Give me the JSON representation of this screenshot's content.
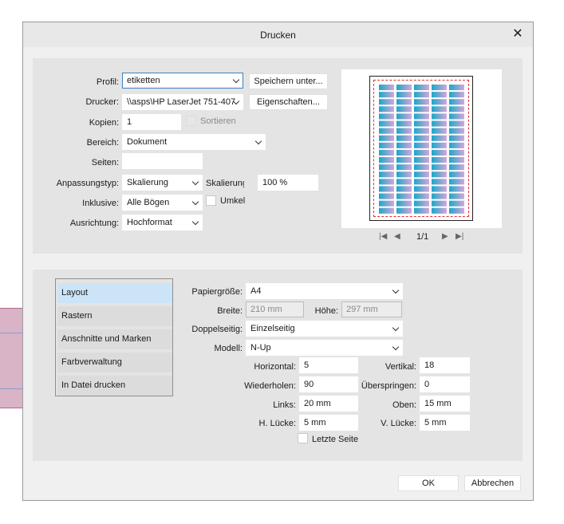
{
  "dialog": {
    "title": "Drucken"
  },
  "top": {
    "profil": {
      "label": "Profil:",
      "value": "etiketten",
      "save_button": "Speichern unter..."
    },
    "drucker": {
      "label": "Drucker:",
      "value": "\\\\asps\\HP LaserJet 751-407",
      "properties_button": "Eigenschaften..."
    },
    "kopien": {
      "label": "Kopien:",
      "value": "1",
      "sortieren": "Sortieren"
    },
    "bereich": {
      "label": "Bereich:",
      "value": "Dokument"
    },
    "seiten": {
      "label": "Seiten:",
      "value": ""
    },
    "anpassungstyp": {
      "label": "Anpassungstyp:",
      "value": "Skalierung",
      "skalierung_label": "Skalierung",
      "skalierung_value": "100 %"
    },
    "inklusive": {
      "label": "Inklusive:",
      "value": "Alle Bögen",
      "umkehren": "Umkel"
    },
    "ausrichtung": {
      "label": "Ausrichtung:",
      "value": "Hochformat"
    }
  },
  "preview": {
    "page_indicator": "1/1",
    "colors": {
      "label_gradient_start": "#1aa7c9",
      "label_gradient_end": "#d6a6d9",
      "margin_line": "#dd3333"
    }
  },
  "nav": {
    "items": [
      {
        "label": "Layout",
        "active": true
      },
      {
        "label": "Rastern",
        "active": false
      },
      {
        "label": "Anschnitte und Marken",
        "active": false
      },
      {
        "label": "Farbverwaltung",
        "active": false
      },
      {
        "label": "In Datei drucken",
        "active": false
      }
    ]
  },
  "layout": {
    "papiergroesse": {
      "label": "Papiergröße:",
      "value": "A4"
    },
    "breite": {
      "label": "Breite:",
      "value": "210 mm"
    },
    "hoehe": {
      "label": "Höhe:",
      "value": "297 mm"
    },
    "doppelseitig": {
      "label": "Doppelseitig:",
      "value": "Einzelseitig"
    },
    "modell": {
      "label": "Modell:",
      "value": "N-Up"
    },
    "horizontal": {
      "label": "Horizontal:",
      "value": "5"
    },
    "vertikal": {
      "label": "Vertikal:",
      "value": "18"
    },
    "wiederholen": {
      "label": "Wiederholen:",
      "value": "90"
    },
    "ueberspringen": {
      "label": "Überspringen:",
      "value": "0"
    },
    "links": {
      "label": "Links:",
      "value": "20 mm"
    },
    "oben": {
      "label": "Oben:",
      "value": "15 mm"
    },
    "h_luecke": {
      "label": "H. Lücke:",
      "value": "5 mm"
    },
    "v_luecke": {
      "label": "V. Lücke:",
      "value": "5 mm"
    },
    "letzte_seite": "Letzte Seite"
  },
  "footer": {
    "ok": "OK",
    "cancel": "Abbrechen"
  }
}
